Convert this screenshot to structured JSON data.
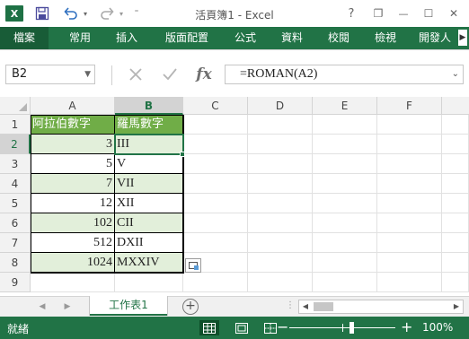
{
  "window": {
    "title": "活頁簿1 - Excel",
    "app_icon_letter": "X",
    "help": "?",
    "restore": "❐",
    "minimize": "—",
    "maximize": "☐",
    "close": "✕"
  },
  "quick_access": {
    "save_icon": "save-icon",
    "undo_icon": "undo-icon",
    "redo_icon": "redo-icon"
  },
  "ribbon": {
    "tabs": [
      "檔案",
      "常用",
      "插入",
      "版面配置",
      "公式",
      "資料",
      "校閱",
      "檢視",
      "開發人"
    ],
    "active_tab": "檔案",
    "scroll_arrow": "▶"
  },
  "formula_bar": {
    "name_box": "B2",
    "formula": "=ROMAN(A2)",
    "fx_label": "fx"
  },
  "sheet": {
    "columns": [
      "A",
      "B",
      "C",
      "D",
      "E",
      "F"
    ],
    "rows": [
      "1",
      "2",
      "3",
      "4",
      "5",
      "6",
      "7",
      "8",
      "9"
    ],
    "selected_column": "B",
    "selected_row": "2",
    "table_headers": [
      "阿拉伯數字",
      "羅馬數字"
    ],
    "arabic": [
      "3",
      "5",
      "7",
      "12",
      "102",
      "512",
      "1024"
    ],
    "roman": [
      "III",
      "V",
      "VII",
      "XII",
      "CII",
      "DXII",
      "MXXIV"
    ],
    "header_color": "#70ad47",
    "band_color": "#e2efda",
    "accent_color": "#217346"
  },
  "tabs_bar": {
    "sheet_tab": "工作表1",
    "add_sheet": "+",
    "prev_arrow": "◀",
    "next_arrow": "▶",
    "dots": "⋮"
  },
  "status_bar": {
    "status": "就緒",
    "zoom": "100%",
    "zoom_minus": "−",
    "zoom_plus": "+"
  }
}
